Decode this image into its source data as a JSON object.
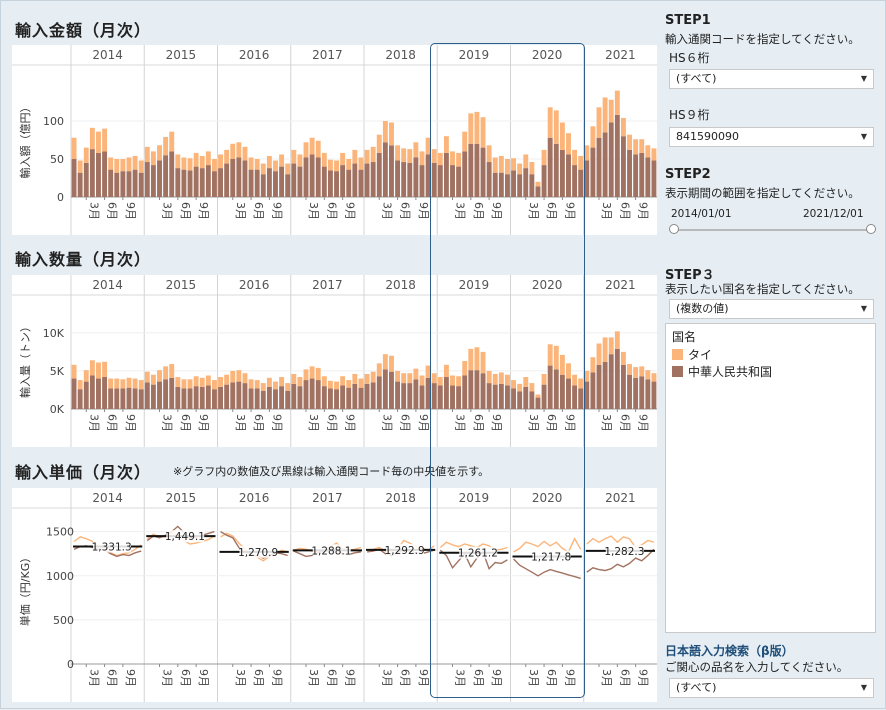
{
  "panels": {
    "amount_title": "輸入金額（月次）",
    "quantity_title": "輸入数量（月次）",
    "price_title": "輸入単価（月次）",
    "price_note": "※グラフ内の数値及び黒線は輸入通関コード毎の中央値を示す。"
  },
  "sidebar": {
    "step1": {
      "label": "STEP1",
      "desc": "輸入通関コードを指定してください。",
      "hs6_label": "HS６桁",
      "hs6_value": "(すべて)",
      "hs9_label": "HS９桁",
      "hs9_value": "841590090"
    },
    "step2": {
      "label": "STEP2",
      "desc": "表示期間の範囲を指定してください。",
      "start": "2014/01/01",
      "end": "2021/12/01"
    },
    "step3": {
      "label": "STEP３",
      "desc": "表示したい国名を指定してください。",
      "value": "(複数の値)"
    },
    "legend": {
      "title": "国名",
      "items": [
        {
          "label": "タイ",
          "color": "#fbb57a"
        },
        {
          "label": "中華人民共和国",
          "color": "#a17261"
        }
      ]
    },
    "search": {
      "title": "日本語入力検索（β版）",
      "desc": "ご関心の品名を入力してください。",
      "value": "(すべて)"
    }
  },
  "colors": {
    "thai": "#fbb57a",
    "china": "#a17261",
    "highlight": "#2e5f8a"
  },
  "chart_data": [
    {
      "type": "bar",
      "title": "輸入金額（月次）",
      "ylabel": "輸入額（億円）",
      "years": [
        "2014",
        "2015",
        "2016",
        "2017",
        "2018",
        "2019",
        "2020",
        "2021"
      ],
      "month_ticks": [
        "3月",
        "6月",
        "9月"
      ],
      "yticks": [
        0,
        50,
        100
      ],
      "ylim": [
        0,
        150
      ],
      "stacked": true,
      "series": [
        {
          "name": "中華人民共和国",
          "values": [
            50,
            32,
            45,
            63,
            58,
            60,
            36,
            32,
            34,
            34,
            36,
            32,
            46,
            42,
            48,
            55,
            60,
            38,
            36,
            35,
            40,
            38,
            42,
            34,
            38,
            44,
            50,
            52,
            48,
            36,
            36,
            30,
            38,
            34,
            40,
            30,
            44,
            40,
            52,
            56,
            52,
            40,
            35,
            34,
            42,
            36,
            44,
            36,
            44,
            46,
            58,
            72,
            68,
            48,
            46,
            45,
            52,
            42,
            56,
            45,
            42,
            58,
            42,
            40,
            60,
            70,
            70,
            65,
            46,
            32,
            32,
            30,
            35,
            30,
            38,
            30,
            14,
            42,
            78,
            70,
            62,
            56,
            42,
            36,
            48,
            65,
            78,
            85,
            98,
            108,
            80,
            62,
            56,
            58,
            52,
            48
          ]
        },
        {
          "name": "タイ",
          "values": [
            28,
            16,
            20,
            28,
            28,
            30,
            16,
            18,
            16,
            18,
            18,
            16,
            20,
            18,
            20,
            24,
            26,
            18,
            16,
            16,
            18,
            16,
            18,
            16,
            18,
            18,
            20,
            20,
            18,
            16,
            14,
            14,
            16,
            14,
            16,
            14,
            18,
            16,
            20,
            22,
            22,
            18,
            14,
            14,
            16,
            14,
            18,
            16,
            18,
            20,
            24,
            28,
            30,
            20,
            18,
            18,
            20,
            18,
            22,
            18,
            16,
            22,
            18,
            18,
            26,
            40,
            42,
            40,
            22,
            20,
            22,
            20,
            16,
            14,
            18,
            16,
            6,
            20,
            40,
            44,
            36,
            28,
            20,
            18,
            20,
            28,
            40,
            46,
            30,
            32,
            24,
            20,
            20,
            18,
            16,
            16
          ]
        }
      ]
    },
    {
      "type": "bar",
      "title": "輸入数量（月次）",
      "ylabel": "輸入量（トン）",
      "years": [
        "2014",
        "2015",
        "2016",
        "2017",
        "2018",
        "2019",
        "2020",
        "2021"
      ],
      "month_ticks": [
        "3月",
        "6月",
        "9月"
      ],
      "yticks": [
        "0K",
        "5K",
        "10K"
      ],
      "ylim": [
        0,
        13000
      ],
      "stacked": true,
      "series": [
        {
          "name": "中華人民共和国",
          "values": [
            4000,
            2600,
            3600,
            4400,
            4000,
            4200,
            2700,
            2700,
            2700,
            2800,
            2700,
            2600,
            3500,
            3200,
            3600,
            3900,
            4100,
            2900,
            2700,
            2700,
            3000,
            2900,
            3100,
            2600,
            2900,
            3200,
            3500,
            3600,
            3400,
            2700,
            2700,
            2400,
            2900,
            2600,
            3000,
            2400,
            3300,
            3000,
            3800,
            4000,
            3800,
            3000,
            2700,
            2600,
            3100,
            2800,
            3300,
            2800,
            3300,
            3500,
            4300,
            5200,
            4900,
            3600,
            3400,
            3400,
            3900,
            3100,
            4100,
            3400,
            3100,
            4200,
            3100,
            3000,
            4400,
            5100,
            5100,
            4700,
            3400,
            3200,
            3300,
            3100,
            2700,
            2300,
            2900,
            2300,
            1500,
            3200,
            5700,
            5200,
            4500,
            4000,
            3100,
            2700,
            3600,
            4800,
            5800,
            6200,
            7200,
            7900,
            5800,
            4500,
            4100,
            4300,
            3900,
            3600
          ]
        },
        {
          "name": "タイ",
          "values": [
            1800,
            1200,
            1500,
            2000,
            2100,
            2000,
            1300,
            1300,
            1200,
            1300,
            1300,
            1200,
            1400,
            1300,
            1500,
            1700,
            1800,
            1300,
            1200,
            1200,
            1300,
            1200,
            1300,
            1200,
            1300,
            1300,
            1500,
            1500,
            1300,
            1200,
            1100,
            1000,
            1200,
            1000,
            1200,
            1000,
            1300,
            1200,
            1400,
            1600,
            1600,
            1300,
            1000,
            1000,
            1200,
            1000,
            1300,
            1200,
            1300,
            1400,
            1700,
            2000,
            2100,
            1400,
            1300,
            1300,
            1400,
            1300,
            1600,
            1300,
            1100,
            1600,
            1300,
            1300,
            1900,
            2800,
            3000,
            2800,
            1600,
            1400,
            1500,
            1400,
            1100,
            1000,
            1300,
            1100,
            400,
            1400,
            2800,
            3100,
            2600,
            2000,
            1400,
            1300,
            1400,
            2000,
            2800,
            3200,
            2200,
            2300,
            1700,
            1400,
            1400,
            1300,
            1200,
            1100
          ]
        }
      ]
    },
    {
      "type": "line",
      "title": "輸入単価（月次）",
      "ylabel": "単価（円/KG）",
      "years": [
        "2014",
        "2015",
        "2016",
        "2017",
        "2018",
        "2019",
        "2020",
        "2021"
      ],
      "month_ticks": [
        "3月",
        "6月",
        "9月"
      ],
      "yticks": [
        0,
        500,
        1000,
        1500
      ],
      "ylim": [
        0,
        1700
      ],
      "medians": [
        1331.3,
        1449.1,
        1270.9,
        1288.1,
        1292.9,
        1261.2,
        1217.8,
        1282.3
      ],
      "median_labels": [
        "1,331.3",
        "1,449.1",
        "1,270.9",
        "1,288.1",
        "1,292.9",
        "1,261.2",
        "1,217.8",
        "1,282.3"
      ],
      "series": [
        {
          "name": "タイ",
          "values": [
            1390,
            1440,
            1420,
            1390,
            1330,
            1320,
            1260,
            1230,
            1250,
            1260,
            1300,
            1350,
            1420,
            1470,
            1440,
            1440,
            1480,
            1470,
            1400,
            1360,
            1370,
            1390,
            1410,
            1450,
            1440,
            1480,
            1450,
            1370,
            1300,
            1240,
            1210,
            1170,
            1220,
            1250,
            1290,
            1270,
            1290,
            1310,
            1300,
            1280,
            1270,
            1290,
            1330,
            1370,
            1310,
            1290,
            1300,
            1320,
            1290,
            1300,
            1320,
            1280,
            1270,
            1300,
            1400,
            1370,
            1330,
            1310,
            1290,
            1340,
            1320,
            1380,
            1350,
            1330,
            1360,
            1340,
            1320,
            1360,
            1340,
            1290,
            1300,
            1320,
            1270,
            1310,
            1380,
            1360,
            1330,
            1390,
            1340,
            1380,
            1310,
            1270,
            1420,
            1300,
            1360,
            1420,
            1380,
            1420,
            1450,
            1380,
            1440,
            1420,
            1320,
            1350,
            1400,
            1380
          ]
        },
        {
          "name": "中華人民共和国",
          "values": [
            1300,
            1330,
            1340,
            1320,
            1300,
            1290,
            1250,
            1220,
            1240,
            1230,
            1260,
            1280,
            1400,
            1450,
            1430,
            1460,
            1500,
            1560,
            1490,
            1420,
            1440,
            1460,
            1480,
            1500,
            1500,
            1460,
            1430,
            1320,
            1270,
            1240,
            1230,
            1200,
            1230,
            1260,
            1250,
            1230,
            1280,
            1250,
            1220,
            1230,
            1260,
            1280,
            1300,
            1290,
            1250,
            1240,
            1260,
            1270,
            1270,
            1280,
            1300,
            1250,
            1230,
            1260,
            1290,
            1280,
            1260,
            1250,
            1270,
            1290,
            1290,
            1230,
            1090,
            1170,
            1250,
            1100,
            1200,
            1270,
            1080,
            1150,
            1140,
            1180,
            1190,
            1120,
            1080,
            1040,
            1000,
            1040,
            1070,
            1050,
            1030,
            1010,
            990,
            970,
            1040,
            1090,
            1070,
            1060,
            1080,
            1130,
            1100,
            1140,
            1200,
            1170,
            1230,
            1300
          ]
        }
      ]
    }
  ]
}
